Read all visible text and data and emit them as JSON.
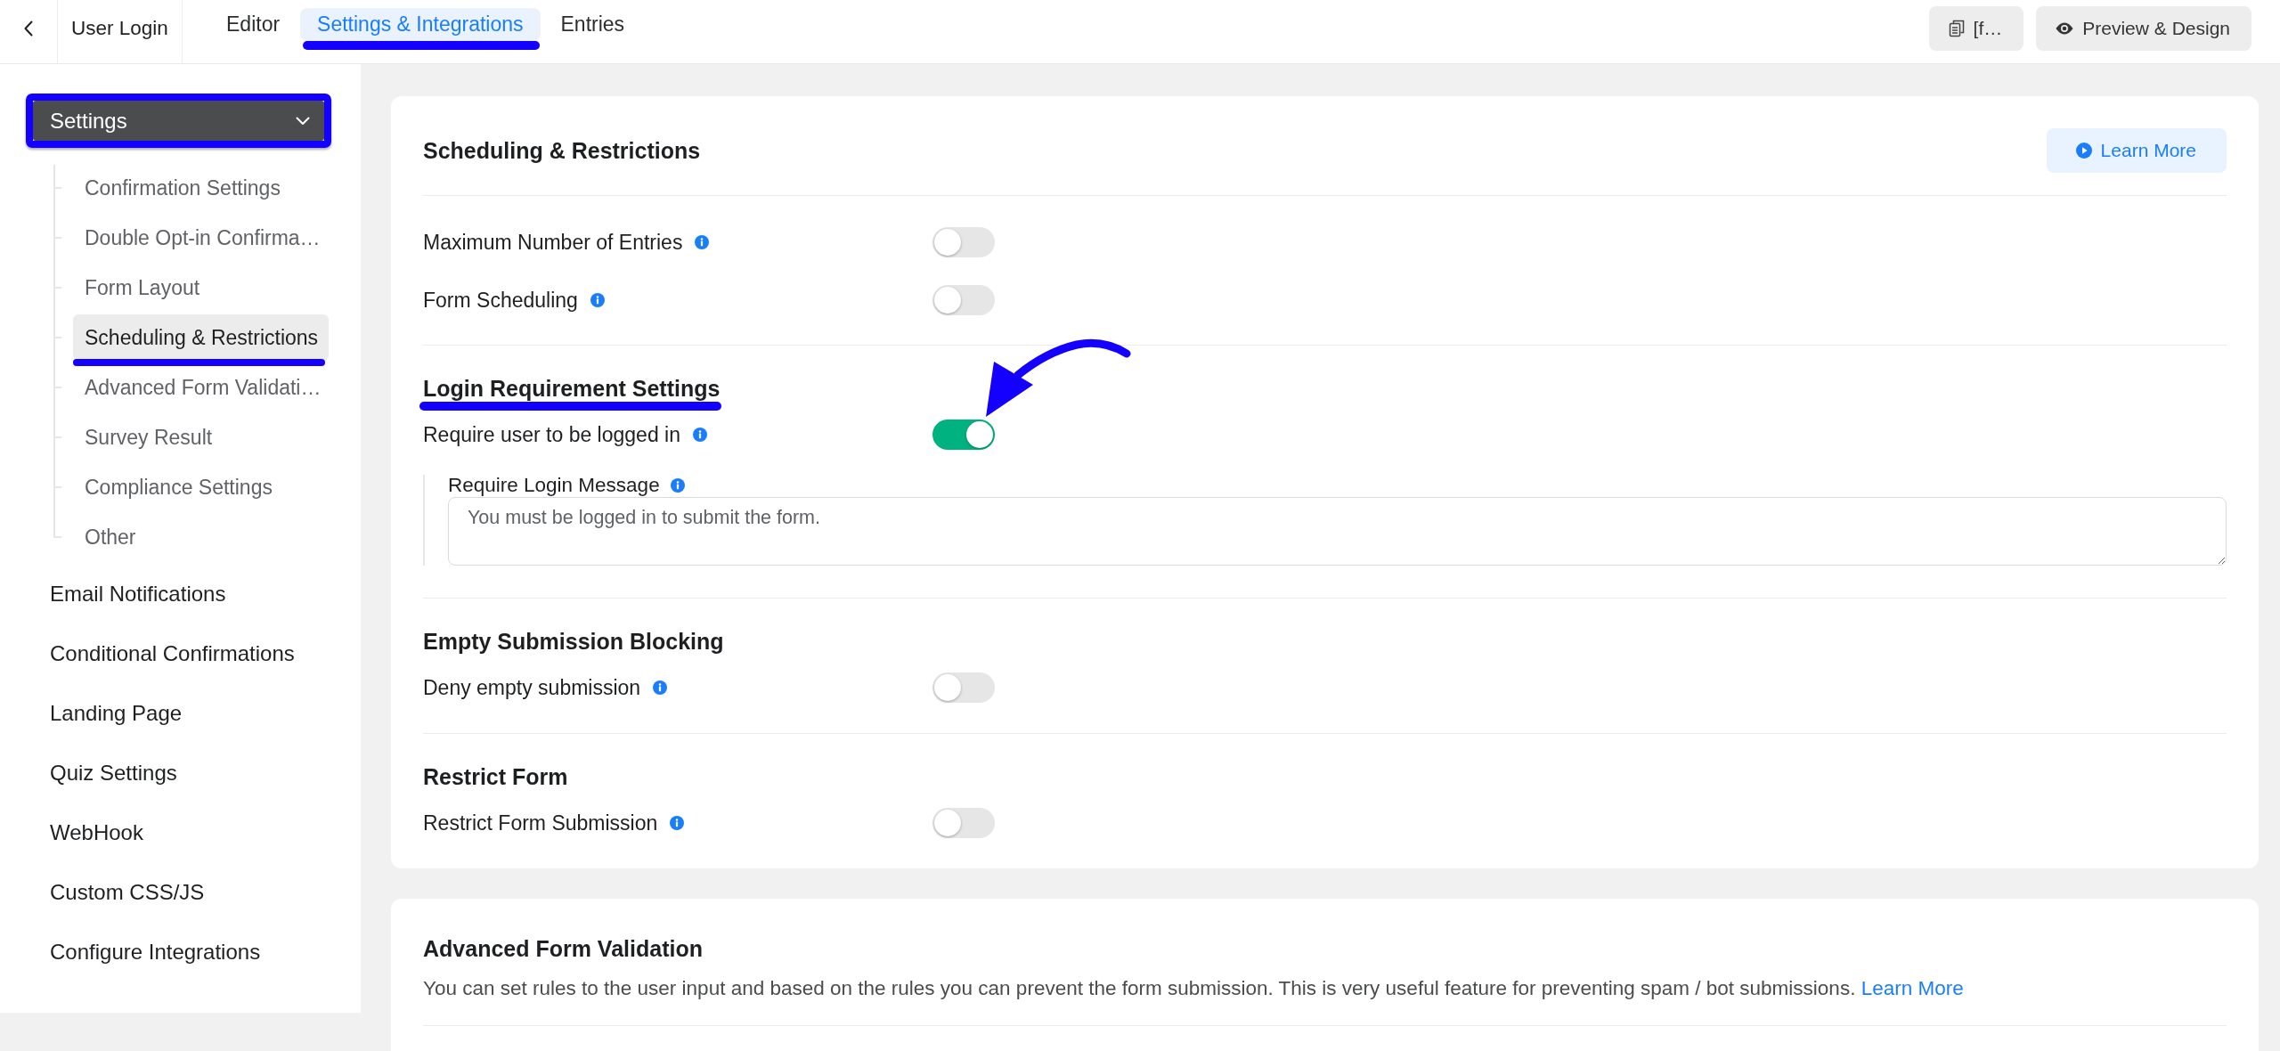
{
  "header": {
    "form_title": "User Login",
    "tabs": [
      {
        "label": "Editor",
        "selected": false,
        "underlined": false
      },
      {
        "label": "Settings & Integrations",
        "selected": true,
        "underlined": true
      },
      {
        "label": "Entries",
        "selected": false,
        "underlined": false
      }
    ],
    "actions": [
      {
        "kind": "shortcode",
        "label": "[f…"
      },
      {
        "kind": "preview",
        "label": "Preview & Design"
      }
    ]
  },
  "sidebar": {
    "menu": {
      "label": "Settings",
      "expanded": true,
      "outlined": true,
      "items": [
        {
          "label": "Confirmation Settings",
          "selected": false,
          "underlined": false
        },
        {
          "label": "Double Opt-in Confirma…",
          "selected": false,
          "underlined": false
        },
        {
          "label": "Form Layout",
          "selected": false,
          "underlined": false
        },
        {
          "label": "Scheduling & Restrictions",
          "selected": true,
          "underlined": true
        },
        {
          "label": "Advanced Form Validati…",
          "selected": false,
          "underlined": false
        },
        {
          "label": "Survey Result",
          "selected": false,
          "underlined": false
        },
        {
          "label": "Compliance Settings",
          "selected": false,
          "underlined": false
        },
        {
          "label": "Other",
          "selected": false,
          "underlined": false
        }
      ]
    },
    "items": [
      {
        "label": "Email Notifications",
        "selected": false
      },
      {
        "label": "Conditional Confirmations",
        "selected": false
      },
      {
        "label": "Landing Page",
        "selected": false
      },
      {
        "label": "Quiz Settings",
        "selected": false
      },
      {
        "label": "WebHook",
        "selected": false
      },
      {
        "label": "Custom CSS/JS",
        "selected": false
      },
      {
        "label": "Configure Integrations",
        "selected": false
      }
    ]
  },
  "scheduling_card": {
    "title": "Scheduling & Restrictions",
    "learn_more": "Learn More",
    "sections": [
      {
        "settings": [
          {
            "label": "Maximum Number of Entries",
            "on": false,
            "arrow": false
          },
          {
            "label": "Form Scheduling",
            "on": false,
            "arrow": false
          }
        ]
      },
      {
        "title": "Login Requirement Settings",
        "underlined": true,
        "settings": [
          {
            "label": "Require user to be logged in",
            "on": true,
            "arrow": true
          }
        ],
        "message": {
          "label": "Require Login Message",
          "value": "You must be logged in to submit the form."
        }
      },
      {
        "title": "Empty Submission Blocking",
        "underlined": false,
        "settings": [
          {
            "label": "Deny empty submission",
            "on": false,
            "arrow": false
          }
        ]
      },
      {
        "title": "Restrict Form",
        "underlined": false,
        "settings": [
          {
            "label": "Restrict Form Submission",
            "on": false,
            "arrow": false
          }
        ]
      }
    ]
  },
  "validation_card": {
    "title": "Advanced Form Validation",
    "description": "You can set rules to the user input and based on the rules you can prevent the form submission. This is very useful feature for preventing spam / bot submissions.",
    "link": "Learn More"
  }
}
